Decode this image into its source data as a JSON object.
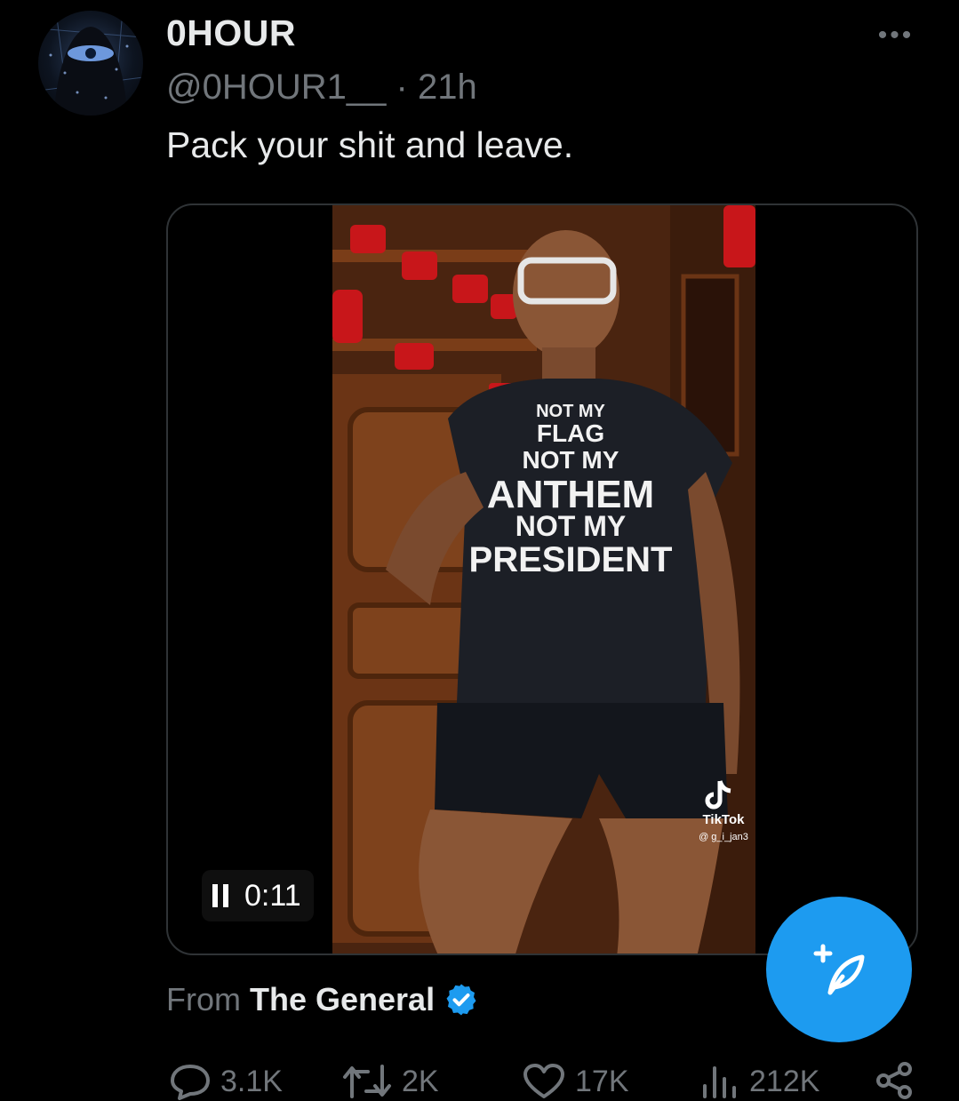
{
  "author": {
    "display_name": "0HOUR",
    "handle": "@0HOUR1__",
    "separator": "·",
    "time_ago": "21h"
  },
  "tweet": {
    "text": "Pack your shit and leave."
  },
  "video": {
    "timestamp": "0:11",
    "shirt_text": [
      "NOT MY",
      "FLAG",
      "NOT MY",
      "ANTHEM",
      "NOT MY",
      "PRESIDENT"
    ],
    "watermark_brand": "TikTok",
    "watermark_user": "@ g_i_jan3"
  },
  "source": {
    "prefix": "From",
    "name": "The General"
  },
  "actions": {
    "replies": "3.1K",
    "reposts": "2K",
    "likes": "17K",
    "views": "212K"
  },
  "colors": {
    "accent": "#1d9bf0",
    "muted": "#71767b",
    "text": "#e7e9ea",
    "background": "#000000"
  },
  "icons": {
    "more": "more-icon",
    "pause": "pause-icon",
    "compose": "compose-icon",
    "verified": "verified-badge-icon",
    "reply": "reply-icon",
    "repost": "repost-icon",
    "like": "like-icon",
    "views": "views-icon",
    "share": "share-icon"
  }
}
